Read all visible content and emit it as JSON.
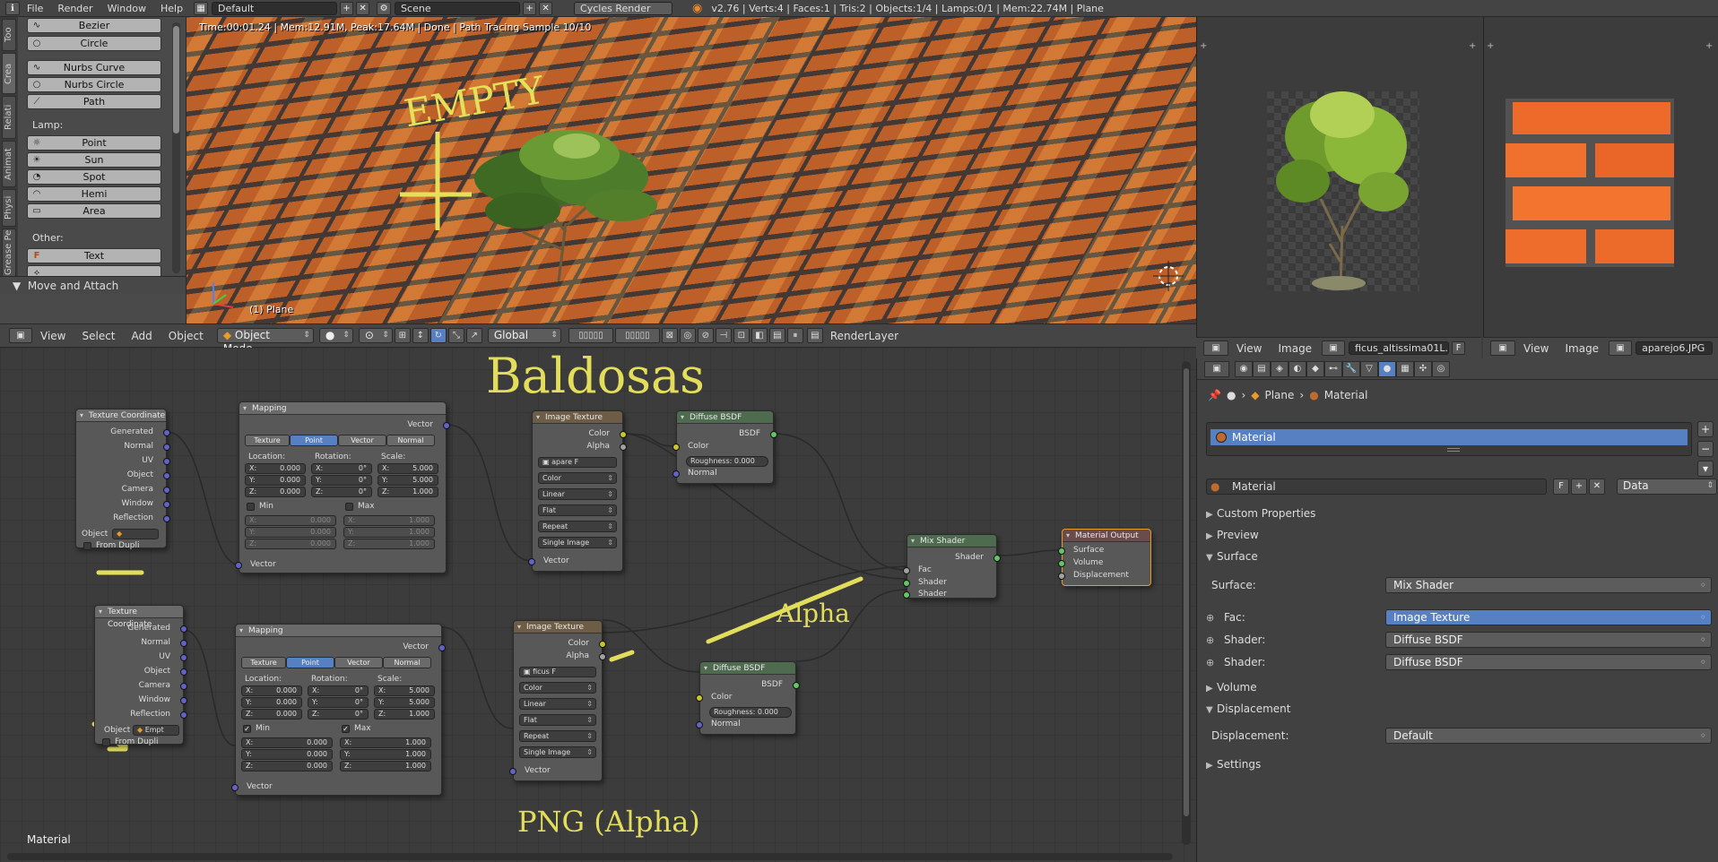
{
  "topbar": {
    "menus": [
      "File",
      "Render",
      "Window",
      "Help"
    ],
    "layout": "Default",
    "scene": "Scene",
    "engine": "Cycles Render",
    "stats": "v2.76 | Verts:4 | Faces:1 | Tris:2 | Objects:1/4 | Lamps:0/1 | Mem:22.74M | Plane"
  },
  "shelf": {
    "tabs": [
      "Too",
      "Crea",
      "Relati",
      "Animat",
      "Physi",
      "Grease Pe"
    ],
    "items_top": [
      "Bezier",
      "Circle",
      "Nurbs Curve",
      "Nurbs Circle",
      "Path"
    ],
    "lamp_label": "Lamp:",
    "lamp_items": [
      "Point",
      "Sun",
      "Spot",
      "Hemi",
      "Area"
    ],
    "other_label": "Other:",
    "other_items": [
      "Text"
    ],
    "panel": "Move and Attach"
  },
  "viewport": {
    "render_info": "Time:00:01.24 | Mem:12.91M, Peak:17.64M | Done | Path Tracing Sample 10/10",
    "object_label": "(1) Plane",
    "empty_annotation": "EMPTY"
  },
  "vp_header": {
    "menus": [
      "View",
      "Select",
      "Add",
      "Object"
    ],
    "mode": "Object Mode",
    "orientation": "Global",
    "render_layer": "RenderLayer"
  },
  "node_editor": {
    "label": "Material",
    "annotations": {
      "top": "Baldosas",
      "alpha": "Alpha",
      "bottom": "PNG (Alpha)"
    },
    "tex_coord_1": {
      "title": "Texture Coordinate",
      "outputs": [
        "Generated",
        "Normal",
        "UV",
        "Object",
        "Camera",
        "Window",
        "Reflection"
      ],
      "object_label": "Object",
      "object_value": "",
      "from_dupli": "From Dupli"
    },
    "tex_coord_2": {
      "title": "Texture Coordinate",
      "outputs": [
        "Generated",
        "Normal",
        "UV",
        "Object",
        "Camera",
        "Window",
        "Reflection"
      ],
      "object_label": "Object",
      "object_value": "Empt",
      "from_dupli": "From Dupli"
    },
    "mapping_1": {
      "title": "Mapping",
      "output": "Vector",
      "types": [
        "Texture",
        "Point",
        "Vector",
        "Normal"
      ],
      "location": "Location:",
      "rotation": "Rotation:",
      "scale": "Scale:",
      "loc": [
        "0.000",
        "0.000",
        "0.000"
      ],
      "rot": [
        "0°",
        "0°",
        "0°"
      ],
      "scl": [
        "5.000",
        "5.000",
        "1.000"
      ],
      "min": "Min",
      "max": "Max",
      "min_vals": [
        "0.000",
        "0.000",
        "0.000"
      ],
      "max_vals": [
        "1.000",
        "1.000",
        "1.000"
      ],
      "input": "Vector"
    },
    "mapping_2": {
      "title": "Mapping",
      "output": "Vector",
      "types": [
        "Texture",
        "Point",
        "Vector",
        "Normal"
      ],
      "location": "Location:",
      "rotation": "Rotation:",
      "scale": "Scale:",
      "loc": [
        "0.000",
        "0.000",
        "0.000"
      ],
      "rot": [
        "0°",
        "0°",
        "0°"
      ],
      "scl": [
        "5.000",
        "5.000",
        "1.000"
      ],
      "min": "Min",
      "max": "Max",
      "min_vals": [
        "0.000",
        "0.000",
        "0.000"
      ],
      "max_vals": [
        "1.000",
        "1.000",
        "1.000"
      ],
      "input": "Vector"
    },
    "img_tex_1": {
      "title": "Image Texture",
      "outputs": [
        "Color",
        "Alpha"
      ],
      "image": "apare",
      "image_flag": "F",
      "opts": [
        "Color",
        "Linear",
        "Flat",
        "Repeat",
        "Single Image"
      ],
      "input": "Vector"
    },
    "img_tex_2": {
      "title": "Image Texture",
      "outputs": [
        "Color",
        "Alpha"
      ],
      "image": "ficus",
      "image_flag": "F",
      "opts": [
        "Color",
        "Linear",
        "Flat",
        "Repeat",
        "Single Image"
      ],
      "input": "Vector"
    },
    "diffuse_1": {
      "title": "Diffuse BSDF",
      "output": "BSDF",
      "inputs": [
        "Color",
        "Normal"
      ],
      "roughness": "Roughness:",
      "roughness_val": "0.000"
    },
    "diffuse_2": {
      "title": "Diffuse BSDF",
      "output": "BSDF",
      "inputs": [
        "Color",
        "Normal"
      ],
      "roughness": "Roughness:",
      "roughness_val": "0.000"
    },
    "mix": {
      "title": "Mix Shader",
      "output": "Shader",
      "inputs": [
        "Fac",
        "Shader",
        "Shader"
      ]
    },
    "output": {
      "title": "Material Output",
      "inputs": [
        "Surface",
        "Volume",
        "Displacement"
      ]
    }
  },
  "image_editor_1": {
    "menus": [
      "View",
      "Image"
    ],
    "image": "ficus_altissima01L...",
    "flag": "F"
  },
  "image_editor_2": {
    "menus": [
      "View",
      "Image"
    ],
    "image": "aparejo6.JPG"
  },
  "properties": {
    "crumb": [
      "Plane",
      "Material"
    ],
    "slot": "Material",
    "material_field": "Material",
    "material_flag": "F",
    "link": "Data",
    "sections": {
      "custom": "Custom Properties",
      "preview": "Preview",
      "surface": "Surface",
      "volume": "Volume",
      "displacement": "Displacement",
      "settings": "Settings"
    },
    "surface_label": "Surface:",
    "surface_value": "Mix Shader",
    "fac_label": "Fac:",
    "fac_value": "Image Texture",
    "shader1_label": "Shader:",
    "shader1_value": "Diffuse BSDF",
    "shader2_label": "Shader:",
    "shader2_value": "Diffuse BSDF",
    "disp_label": "Displacement:",
    "disp_value": "Default"
  },
  "colors": {
    "accent": "#5680c2",
    "annotation": "#e2de5c",
    "brick": "#c9692e"
  }
}
